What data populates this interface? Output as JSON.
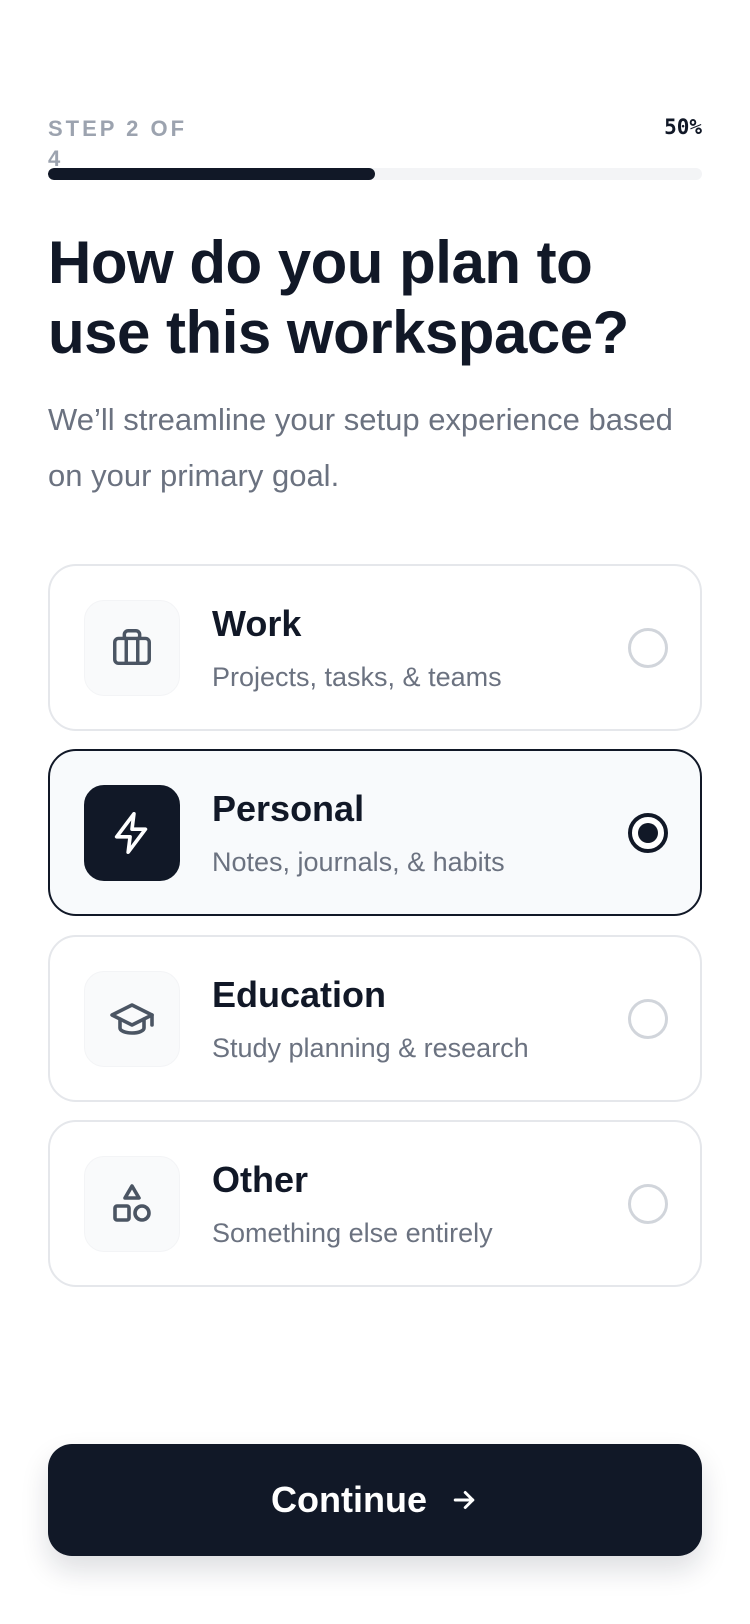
{
  "progress": {
    "step_label": "STEP 2 OF 4",
    "percent_label": "50%",
    "fraction": 0.5
  },
  "header": {
    "title": "How do you plan to use this workspace?",
    "subtitle": "We’ll streamline your setup experience based on your primary goal."
  },
  "options": [
    {
      "title": "Work",
      "description": "Projects, tasks, & teams",
      "icon": "briefcase-icon",
      "selected": false
    },
    {
      "title": "Personal",
      "description": "Notes, journals, & habits",
      "icon": "lightning-icon",
      "selected": true
    },
    {
      "title": "Education",
      "description": "Study planning & research",
      "icon": "graduation-cap-icon",
      "selected": false
    },
    {
      "title": "Other",
      "description": "Something else entirely",
      "icon": "shapes-icon",
      "selected": false
    }
  ],
  "footer": {
    "continue_label": "Continue",
    "continue_icon": "arrow-right-icon"
  },
  "colors": {
    "primary": "#111827",
    "muted_text": "#6b7280",
    "border": "#e5e7eb",
    "selected_bg": "#f8fafc"
  }
}
